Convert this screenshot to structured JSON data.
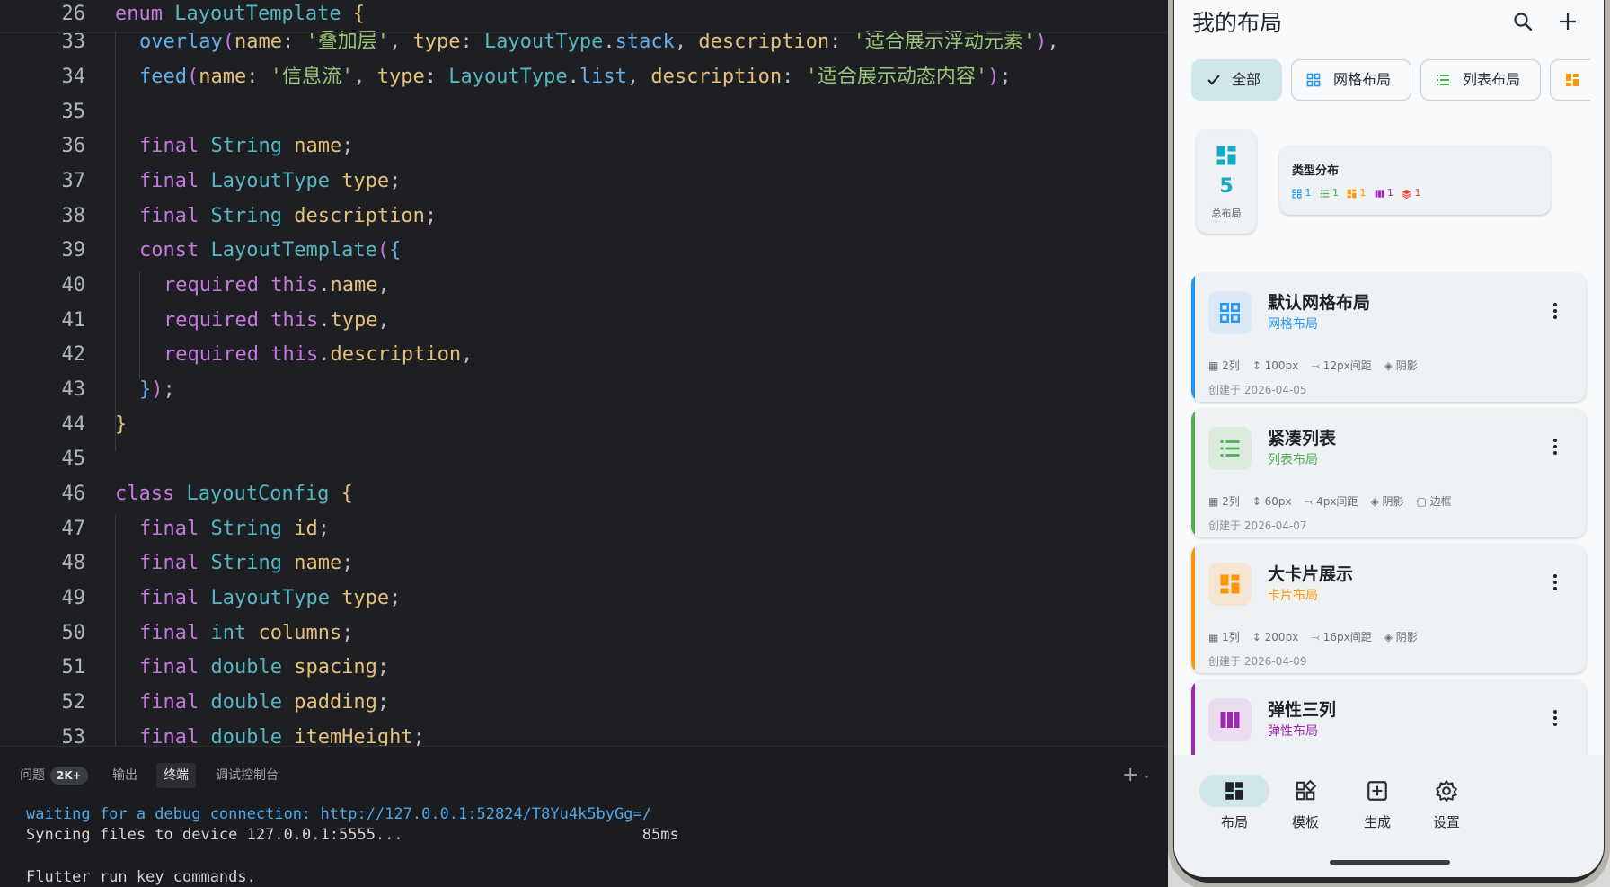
{
  "editor": {
    "lines": [
      {
        "n": "26",
        "indent": 0,
        "tokens": [
          [
            "kw",
            "enum "
          ],
          [
            "cls",
            "LayoutTemplate "
          ],
          [
            "b1",
            "{"
          ]
        ]
      },
      {
        "n": "33",
        "indent": 1,
        "tokens": [
          [
            "fn",
            "overlay"
          ],
          [
            "b2",
            "("
          ],
          [
            "fld",
            "name"
          ],
          [
            "pun",
            ": "
          ],
          [
            "str",
            "'叠加层'"
          ],
          [
            "pun",
            ", "
          ],
          [
            "fld",
            "type"
          ],
          [
            "pun",
            ": "
          ],
          [
            "cls",
            "LayoutType"
          ],
          [
            "pun",
            "."
          ],
          [
            "fn",
            "stack"
          ],
          [
            "pun",
            ", "
          ],
          [
            "fld",
            "description"
          ],
          [
            "pun",
            ": "
          ],
          [
            "str",
            "'适合展示浮动元素'"
          ],
          [
            "b2",
            ")"
          ],
          [
            "pun",
            ","
          ]
        ]
      },
      {
        "n": "34",
        "indent": 1,
        "tokens": [
          [
            "fn",
            "feed"
          ],
          [
            "b2",
            "("
          ],
          [
            "fld",
            "name"
          ],
          [
            "pun",
            ": "
          ],
          [
            "str",
            "'信息流'"
          ],
          [
            "pun",
            ", "
          ],
          [
            "fld",
            "type"
          ],
          [
            "pun",
            ": "
          ],
          [
            "cls",
            "LayoutType"
          ],
          [
            "pun",
            "."
          ],
          [
            "fn",
            "list"
          ],
          [
            "pun",
            ", "
          ],
          [
            "fld",
            "description"
          ],
          [
            "pun",
            ": "
          ],
          [
            "str",
            "'适合展示动态内容'"
          ],
          [
            "b2",
            ")"
          ],
          [
            "pun",
            ";"
          ]
        ]
      },
      {
        "n": "35",
        "indent": 0,
        "tokens": []
      },
      {
        "n": "36",
        "indent": 1,
        "tokens": [
          [
            "kw",
            "final "
          ],
          [
            "cls",
            "String "
          ],
          [
            "fld",
            "name"
          ],
          [
            "pun",
            ";"
          ]
        ]
      },
      {
        "n": "37",
        "indent": 1,
        "tokens": [
          [
            "kw",
            "final "
          ],
          [
            "cls",
            "LayoutType "
          ],
          [
            "fld",
            "type"
          ],
          [
            "pun",
            ";"
          ]
        ]
      },
      {
        "n": "38",
        "indent": 1,
        "tokens": [
          [
            "kw",
            "final "
          ],
          [
            "cls",
            "String "
          ],
          [
            "fld",
            "description"
          ],
          [
            "pun",
            ";"
          ]
        ]
      },
      {
        "n": "39",
        "indent": 1,
        "tokens": [
          [
            "kw",
            "const "
          ],
          [
            "cls",
            "LayoutTemplate"
          ],
          [
            "b2",
            "("
          ],
          [
            "b3",
            "{"
          ]
        ]
      },
      {
        "n": "40",
        "indent": 2,
        "tokens": [
          [
            "kw",
            "required "
          ],
          [
            "kw",
            "this"
          ],
          [
            "pun",
            "."
          ],
          [
            "fld",
            "name"
          ],
          [
            "pun",
            ","
          ]
        ]
      },
      {
        "n": "41",
        "indent": 2,
        "tokens": [
          [
            "kw",
            "required "
          ],
          [
            "kw",
            "this"
          ],
          [
            "pun",
            "."
          ],
          [
            "fld",
            "type"
          ],
          [
            "pun",
            ","
          ]
        ]
      },
      {
        "n": "42",
        "indent": 2,
        "tokens": [
          [
            "kw",
            "required "
          ],
          [
            "kw",
            "this"
          ],
          [
            "pun",
            "."
          ],
          [
            "fld",
            "description"
          ],
          [
            "pun",
            ","
          ]
        ]
      },
      {
        "n": "43",
        "indent": 1,
        "tokens": [
          [
            "b3",
            "}"
          ],
          [
            "b2",
            ")"
          ],
          [
            "pun",
            ";"
          ]
        ]
      },
      {
        "n": "44",
        "indent": 0,
        "tokens": [
          [
            "b1",
            "}"
          ]
        ]
      },
      {
        "n": "45",
        "indent": 0,
        "tokens": []
      },
      {
        "n": "46",
        "indent": 0,
        "tokens": [
          [
            "kw",
            "class "
          ],
          [
            "cls",
            "LayoutConfig "
          ],
          [
            "b1",
            "{"
          ]
        ]
      },
      {
        "n": "47",
        "indent": 1,
        "tokens": [
          [
            "kw",
            "final "
          ],
          [
            "cls",
            "String "
          ],
          [
            "fld",
            "id"
          ],
          [
            "pun",
            ";"
          ]
        ]
      },
      {
        "n": "48",
        "indent": 1,
        "tokens": [
          [
            "kw",
            "final "
          ],
          [
            "cls",
            "String "
          ],
          [
            "fld",
            "name"
          ],
          [
            "pun",
            ";"
          ]
        ]
      },
      {
        "n": "49",
        "indent": 1,
        "tokens": [
          [
            "kw",
            "final "
          ],
          [
            "cls",
            "LayoutType "
          ],
          [
            "fld",
            "type"
          ],
          [
            "pun",
            ";"
          ]
        ]
      },
      {
        "n": "50",
        "indent": 1,
        "tokens": [
          [
            "kw",
            "final "
          ],
          [
            "cls",
            "int "
          ],
          [
            "fld",
            "columns"
          ],
          [
            "pun",
            ";"
          ]
        ]
      },
      {
        "n": "51",
        "indent": 1,
        "tokens": [
          [
            "kw",
            "final "
          ],
          [
            "cls",
            "double "
          ],
          [
            "fld",
            "spacing"
          ],
          [
            "pun",
            ";"
          ]
        ]
      },
      {
        "n": "52",
        "indent": 1,
        "tokens": [
          [
            "kw",
            "final "
          ],
          [
            "cls",
            "double "
          ],
          [
            "fld",
            "padding"
          ],
          [
            "pun",
            ";"
          ]
        ]
      },
      {
        "n": "53",
        "indent": 1,
        "tokens": [
          [
            "kw",
            "final "
          ],
          [
            "cls",
            "double "
          ],
          [
            "fld",
            "itemHeight"
          ],
          [
            "pun",
            ";"
          ]
        ]
      }
    ]
  },
  "panel": {
    "tabs": [
      {
        "label": "问题",
        "badge": "2K+"
      },
      {
        "label": "输出"
      },
      {
        "label": "终端",
        "active": true
      },
      {
        "label": "调试控制台"
      }
    ],
    "add_label": "+",
    "terminal": [
      "waiting for a debug connection: http://127.0.0.1:52824/T8Yu4k5byGg=/",
      "Syncing files to device 127.0.0.1:5555...                          85ms",
      "",
      "Flutter run key commands."
    ],
    "terminal_link_color": "#4fa6e8"
  },
  "app": {
    "title": "我的布局",
    "filters": [
      {
        "label": "全部",
        "selected": true
      },
      {
        "label": "网格布局"
      },
      {
        "label": "列表布局"
      }
    ],
    "summary": {
      "total": "5",
      "total_label": "总布局",
      "dist_title": "类型分布",
      "dist": [
        {
          "icon": "grid-icon",
          "count": "1",
          "color": "#2196f3"
        },
        {
          "icon": "list-icon",
          "count": "1",
          "color": "#4caf50"
        },
        {
          "icon": "card-icon",
          "count": "1",
          "color": "#ff9800"
        },
        {
          "icon": "columns-icon",
          "count": "1",
          "color": "#9c27b0"
        },
        {
          "icon": "layers-icon",
          "count": "1",
          "color": "#f44336"
        }
      ]
    },
    "cards": [
      {
        "title": "默认网格布局",
        "type": "网格布局",
        "color": "#2196f3",
        "bg": "#dbe9f6",
        "icon": "grid-icon",
        "meta": [
          "2列",
          "100px",
          "12px间距",
          "阴影"
        ],
        "date": "创建于 2026-04-05"
      },
      {
        "title": "紧凑列表",
        "type": "列表布局",
        "color": "#4caf50",
        "bg": "#dcebdd",
        "icon": "list-icon",
        "meta": [
          "2列",
          "60px",
          "4px间距",
          "阴影",
          "边框"
        ],
        "date": "创建于 2026-04-07"
      },
      {
        "title": "大卡片展示",
        "type": "卡片布局",
        "color": "#ff9800",
        "bg": "#f4e6d3",
        "icon": "card-icon",
        "meta": [
          "1列",
          "200px",
          "16px间距",
          "阴影"
        ],
        "date": "创建于 2026-04-09"
      },
      {
        "title": "弹性三列",
        "type": "弹性布局",
        "color": "#9c27b0",
        "bg": "#ebdcef",
        "icon": "columns-icon",
        "meta": [],
        "date": ""
      }
    ],
    "nav": [
      {
        "label": "布局",
        "icon": "dashboard-icon",
        "active": true
      },
      {
        "label": "模板",
        "icon": "template-icon"
      },
      {
        "label": "生成",
        "icon": "add-box-icon"
      },
      {
        "label": "设置",
        "icon": "gear-icon"
      }
    ]
  }
}
